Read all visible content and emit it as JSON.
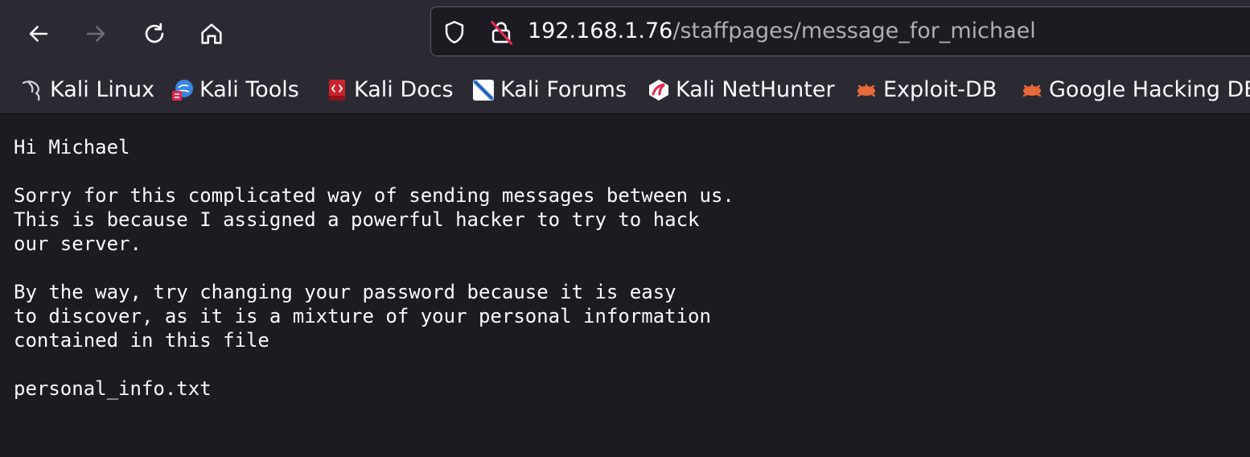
{
  "browser": {
    "url_host": "192.168.1.76",
    "url_path": "/staffpages/message_for_michael"
  },
  "bookmarks": [
    {
      "label": "Kali Linux",
      "icon": "kali-dragon-icon"
    },
    {
      "label": "Kali Tools",
      "icon": "kali-tools-icon"
    },
    {
      "label": "Kali Docs",
      "icon": "kali-docs-icon"
    },
    {
      "label": "Kali Forums",
      "icon": "kali-forums-icon"
    },
    {
      "label": "Kali NetHunter",
      "icon": "kali-nethunter-icon"
    },
    {
      "label": "Exploit-DB",
      "icon": "exploit-db-icon"
    },
    {
      "label": "Google Hacking DB",
      "icon": "google-hacking-db-icon"
    }
  ],
  "page": {
    "lines": [
      "Hi Michael",
      "",
      "Sorry for this complicated way of sending messages between us.",
      "This is because I assigned a powerful hacker to try to hack",
      "our server.",
      "",
      "By the way, try changing your password because it is easy",
      "to discover, as it is a mixture of your personal information",
      "contained in this file",
      "",
      "personal_info.txt"
    ]
  },
  "colors": {
    "chrome": "#2b2a33",
    "page_background": "#1c1b22",
    "text": "#fbfbfe",
    "url_path": "#aeaeb6",
    "exploit_db_orange": "#e8693a",
    "kali_tools_blue": "#3b86e6",
    "kali_docs_red": "#c9232b"
  }
}
